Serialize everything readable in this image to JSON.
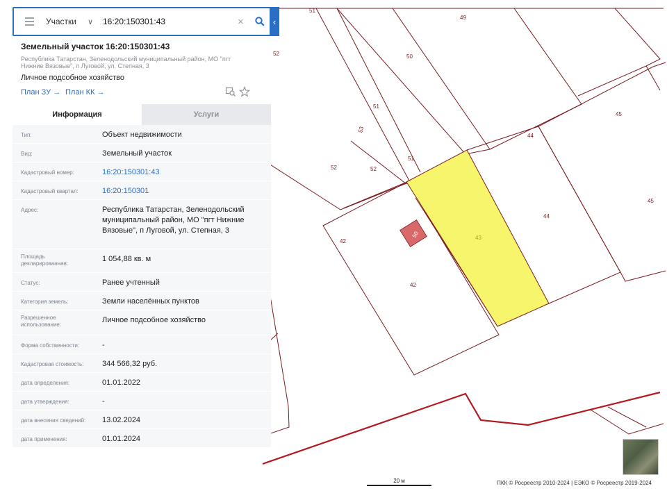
{
  "search": {
    "category": "Участки",
    "query": "16:20:150301:43"
  },
  "parcel": {
    "title": "Земельный участок 16:20:150301:43",
    "address_small": "Республика Татарстан, Зеленодольский муниципальный район, МО \"пгт Нижние Вязовые\", п Луговой, ул. Степная, 3",
    "purpose": "Личное подсобное хозяйство",
    "link_plan_zu": "План ЗУ →",
    "link_plan_kk": "План КК →"
  },
  "tabs": {
    "info": "Информация",
    "services": "Услуги"
  },
  "rows": [
    {
      "label": "Тип:",
      "value": "Объект недвижимости"
    },
    {
      "label": "Вид:",
      "value": "Земельный участок"
    },
    {
      "label": "Кадастровый номер:",
      "value": "16:20:150301:43"
    },
    {
      "label": "Кадастровый квартал:",
      "value": "16:20:150301"
    },
    {
      "label": "Адрес:",
      "value": "Республика Татарстан, Зеленодольский муниципальный район, МО \"пгт Нижние Вязовые\", п Луговой, ул. Степная, 3"
    },
    {
      "label": "Площадь декларированная:",
      "value": "1 054,88 кв. м"
    },
    {
      "label": "Статус:",
      "value": "Ранее учтенный"
    },
    {
      "label": "Категория земель:",
      "value": "Земли населённых пунктов"
    },
    {
      "label": "Разрешенное использование:",
      "value": "Личное подсобное хозяйство"
    },
    {
      "label": "Форма собственности:",
      "value": "-"
    },
    {
      "label": "Кадастровая стоимость:",
      "value": "344 566,32 руб."
    },
    {
      "label": "дата определения:",
      "value": "01.01.2022"
    },
    {
      "label": "дата утверждения:",
      "value": "-"
    },
    {
      "label": "дата внесения сведений:",
      "value": "13.02.2024"
    },
    {
      "label": "дата применения:",
      "value": "01.01.2024"
    }
  ],
  "map": {
    "labels": {
      "l51a": "51",
      "l49": "49",
      "l52a": "52",
      "l50": "50",
      "l51b": "51",
      "l53": "53",
      "l45a": "45",
      "l44a": "44",
      "l51c": "51",
      "l52b": "52",
      "l52c": "52",
      "l45b": "45",
      "l44b": "44",
      "l42a": "42",
      "l43": "43",
      "l42b": "42",
      "bldg": "50"
    },
    "scale": "20 м",
    "copyright": "ПКК © Росреестр 2010-2024 | ЕЭКО © Росреестр 2019-2024",
    "colors": {
      "boundary": "#7a1a1f",
      "highlight": "#f7f56b",
      "building": "#d9686b",
      "quarter": "#b3191f"
    }
  }
}
